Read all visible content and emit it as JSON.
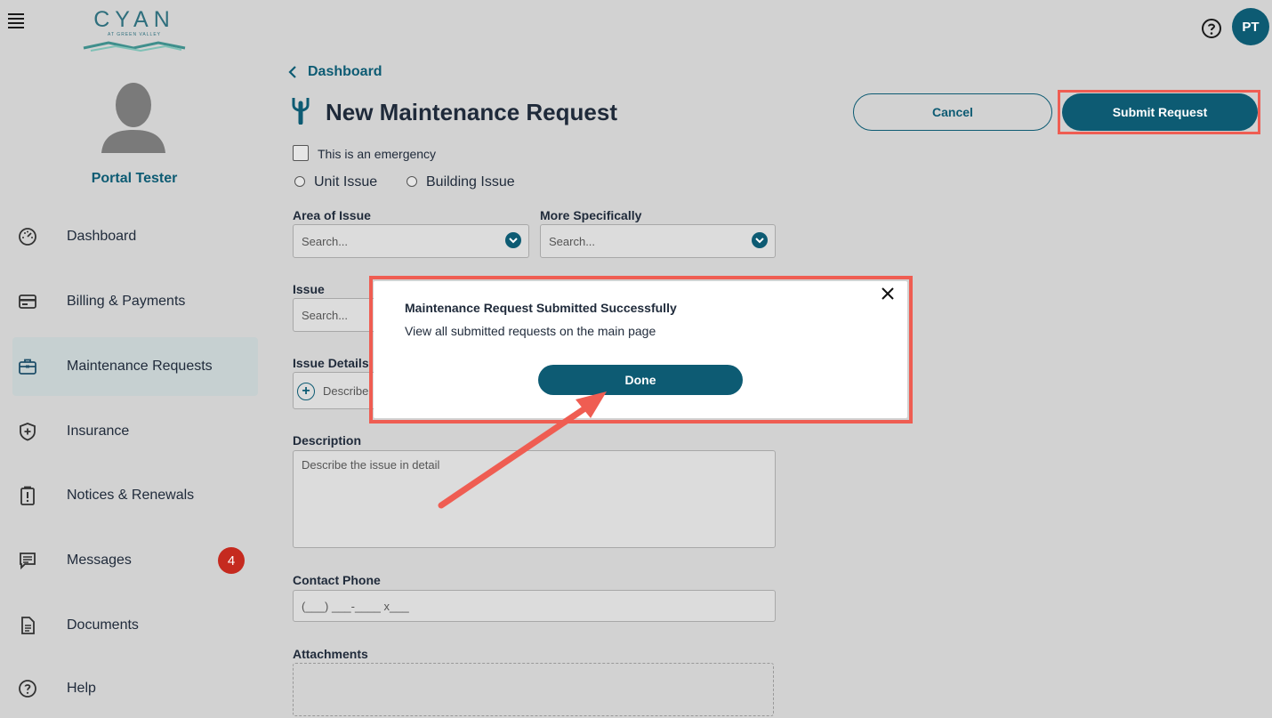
{
  "app": {
    "logo_word": "CYAN",
    "logo_sub": "AT GREEN VALLEY",
    "user_initials": "PT"
  },
  "profile": {
    "name": "Portal Tester"
  },
  "sidebar": {
    "items": [
      {
        "label": "Dashboard",
        "icon": "gauge-icon"
      },
      {
        "label": "Billing & Payments",
        "icon": "credit-card-icon"
      },
      {
        "label": "Maintenance Requests",
        "icon": "toolbox-icon",
        "active": true
      },
      {
        "label": "Insurance",
        "icon": "shield-plus-icon"
      },
      {
        "label": "Notices & Renewals",
        "icon": "clipboard-alert-icon"
      },
      {
        "label": "Messages",
        "icon": "message-icon",
        "badge": "4"
      },
      {
        "label": "Documents",
        "icon": "document-icon"
      },
      {
        "label": "Help",
        "icon": "help-circle-icon"
      }
    ]
  },
  "main": {
    "back_label": "Dashboard",
    "title": "New Maintenance Request",
    "cancel_label": "Cancel",
    "submit_label": "Submit Request",
    "emergency_label": "This is an emergency",
    "radio_unit": "Unit Issue",
    "radio_building": "Building Issue",
    "area_label": "Area of Issue",
    "area_placeholder": "Search...",
    "specific_label": "More Specifically",
    "specific_placeholder": "Search...",
    "issue_label": "Issue",
    "issue_placeholder": "Search...",
    "details_label": "Issue Details",
    "details_placeholder": "Describe",
    "description_label": "Description",
    "description_placeholder": "Describe the issue in detail",
    "phone_label": "Contact Phone",
    "phone_placeholder": "(___) ___-____ x___",
    "attachments_label": "Attachments"
  },
  "modal": {
    "title": "Maintenance Request Submitted Successfully",
    "text": "View all submitted requests on the main page",
    "done_label": "Done"
  },
  "colors": {
    "brand": "#0d5b73",
    "highlight": "#ef5d52",
    "badge": "#c52a1f"
  }
}
